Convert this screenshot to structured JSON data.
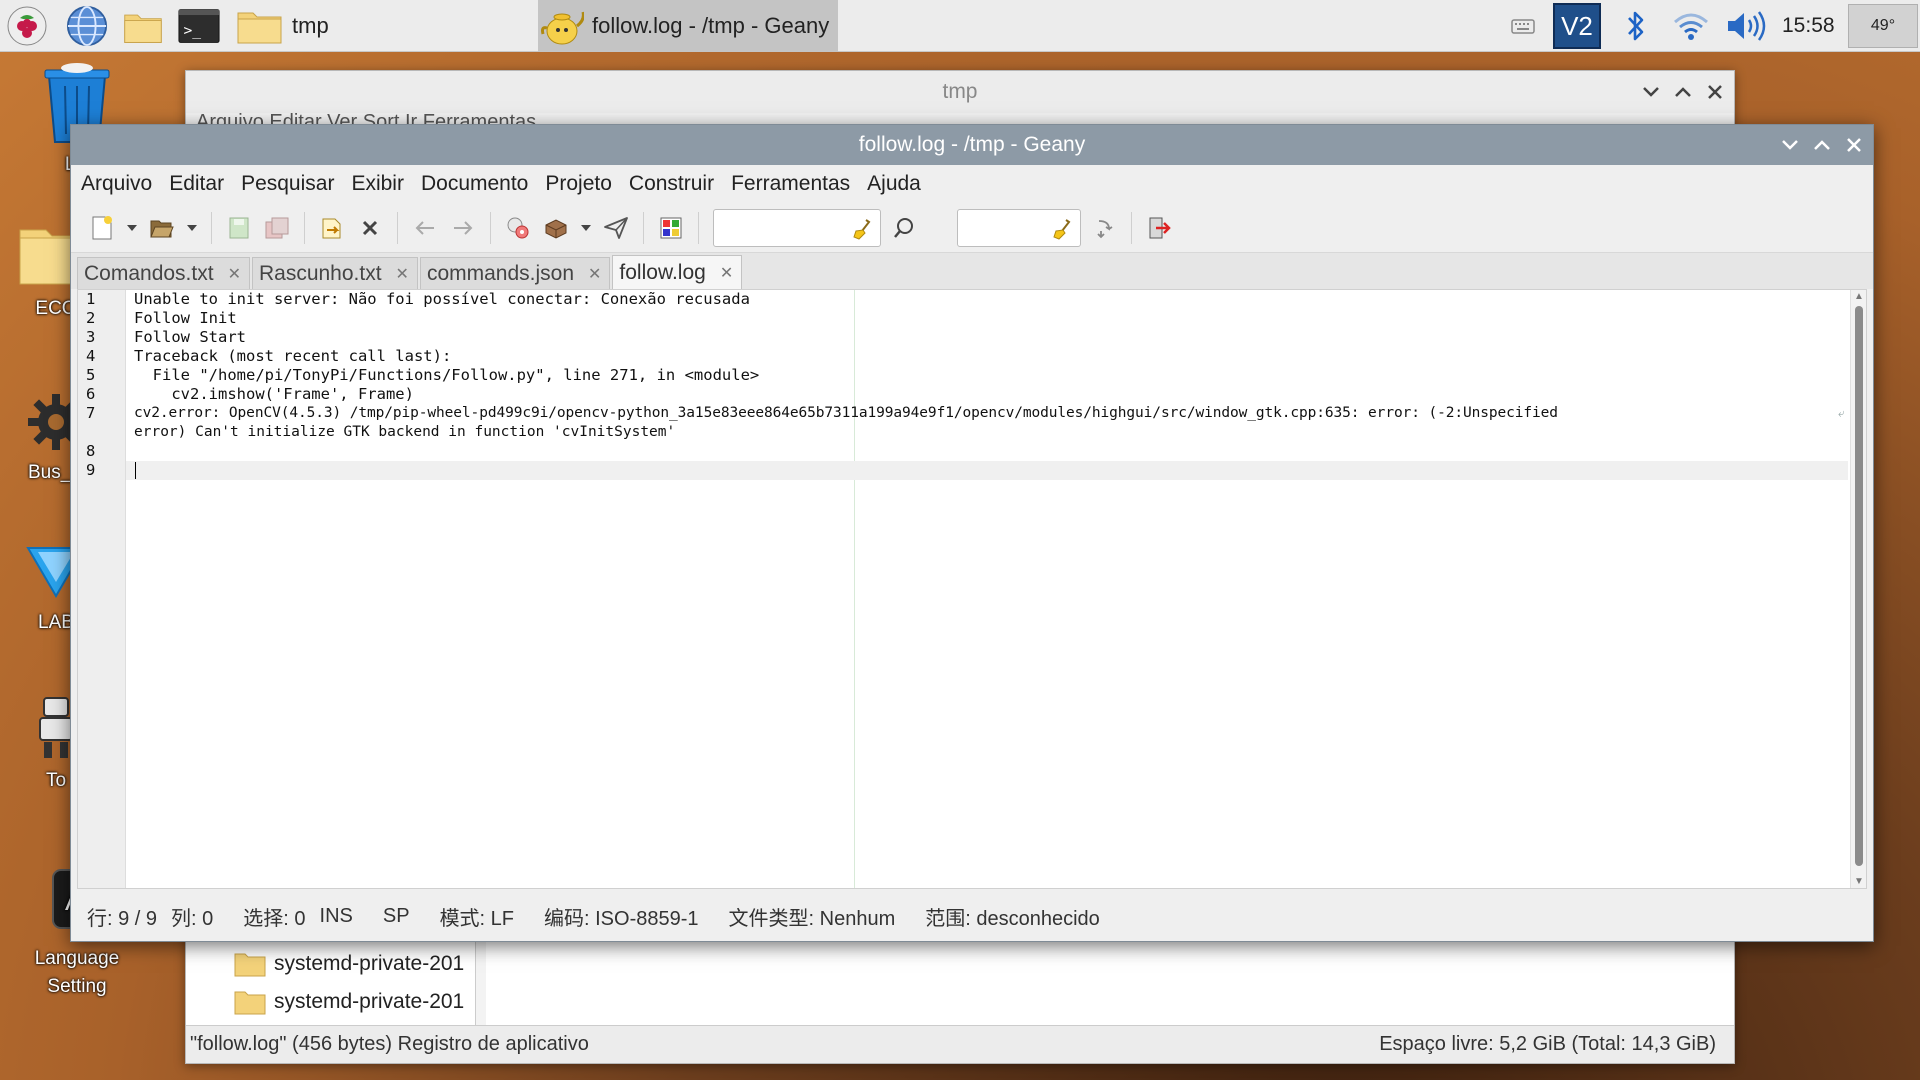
{
  "taskbar": {
    "folder_task_label": "tmp",
    "geany_task_label": "follow.log - /tmp - Geany",
    "clock": "15:58",
    "temperature": "49°",
    "tray_vnc_label": "V2"
  },
  "desktop": {
    "icons": [
      {
        "label": "Lix"
      },
      {
        "label": "ECO"
      },
      {
        "label": "Bus_S"
      },
      {
        "label": "LAB"
      },
      {
        "label": "To"
      },
      {
        "label": "Language\nSetting"
      }
    ]
  },
  "file_manager": {
    "title": "tmp",
    "menu_text": "Arquivo  Editar  Ver  Sort  Ir  Ferramentas",
    "rows": [
      {
        "name": "systemd-private-201"
      },
      {
        "name": "systemd-private-201"
      }
    ],
    "status_left": "\"follow.log\" (456 bytes) Registro de aplicativo",
    "status_right": "Espaço livre: 5,2 GiB (Total: 14,3 GiB)"
  },
  "geany": {
    "title": "follow.log - /tmp - Geany",
    "menu": [
      "Arquivo",
      "Editar",
      "Pesquisar",
      "Exibir",
      "Documento",
      "Projeto",
      "Construir",
      "Ferramentas",
      "Ajuda"
    ],
    "search_placeholder": "",
    "goto_placeholder": "",
    "tabs": [
      {
        "label": "Comandos.txt",
        "active": false
      },
      {
        "label": "Rascunho.txt",
        "active": false
      },
      {
        "label": "commands.json",
        "active": false
      },
      {
        "label": "follow.log",
        "active": true
      }
    ],
    "line_numbers": [
      "1",
      "2",
      "3",
      "4",
      "5",
      "6",
      "7",
      "8",
      "9"
    ],
    "lines": [
      "Unable to init server: Não foi possível conectar: Conexão recusada",
      "Follow Init",
      "Follow Start",
      "Traceback (most recent call last):",
      "  File \"/home/pi/TonyPi/Functions/Follow.py\", line 271, in <module>",
      "    cv2.imshow('Frame', Frame)",
      "cv2.error: OpenCV(4.5.3) /tmp/pip-wheel-pd499c9i/opencv-python_3a15e83eee864e65b7311a199a94e9f1/opencv/modules/highgui/src/window_gtk.cpp:635: error: (-2:Unspecified",
      "error) Can't initialize GTK backend in function 'cvInitSystem'",
      "",
      ""
    ],
    "status": {
      "line": "行: 9 / 9",
      "col": "列: 0",
      "sel": "选择: 0",
      "ins": "INS",
      "sp": "SP",
      "mode": "模式: LF",
      "encoding": "编码: ISO-8859-1",
      "filetype": "文件类型: Nenhum",
      "scope": "范围: desconhecido"
    }
  }
}
